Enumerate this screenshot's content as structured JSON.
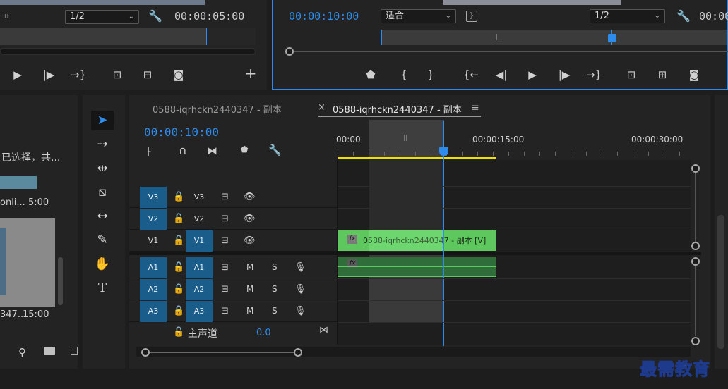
{
  "source_monitor": {
    "resolution": "1/2",
    "timecode": "00:00:05:00"
  },
  "program_monitor": {
    "timecode": "00:00:10:00",
    "zoom": "适合",
    "resolution": "1/2",
    "timecode_right": "00:00"
  },
  "project_panel": {
    "selection_text": "已选择，共...",
    "item1_name": "onli...",
    "item1_duration": "5:00",
    "item2_name": "347...",
    "item2_duration": "15:00"
  },
  "timeline": {
    "tab_inactive": "0588-iqrhckn2440347 - 副本",
    "tab_active": "0588-iqrhckn2440347 - 副本",
    "tab_close": "×",
    "tab_menu": "≡",
    "playhead_timecode": "00:00:10:00",
    "ruler": [
      "00:00",
      "00:00:15:00",
      "00:00:30:00"
    ],
    "video_tracks": [
      {
        "src": "V3",
        "tgt": "V3",
        "src_on": true,
        "tgt_on": false
      },
      {
        "src": "V2",
        "tgt": "V2",
        "src_on": true,
        "tgt_on": false
      },
      {
        "src": "V1",
        "tgt": "V1",
        "src_on": false,
        "tgt_on": true
      }
    ],
    "audio_tracks": [
      {
        "src": "A1",
        "tgt": "A1",
        "m": "M",
        "s": "S"
      },
      {
        "src": "A2",
        "tgt": "A2",
        "m": "M",
        "s": "S"
      },
      {
        "src": "A3",
        "tgt": "A3",
        "m": "M",
        "s": "S"
      }
    ],
    "master_label": "主声道",
    "master_value": "0.0",
    "video_clip_label": "0588-iqrhckn2440347 - 副本 [V]",
    "fx_label": "fx"
  },
  "watermark": "最需教育",
  "colors": {
    "accent_blue": "#2d8ceb",
    "video_clip": "#5ec85e",
    "audio_clip": "#2f6e3a",
    "work_area": "#f0e000",
    "track_target": "#1a5c8a"
  }
}
